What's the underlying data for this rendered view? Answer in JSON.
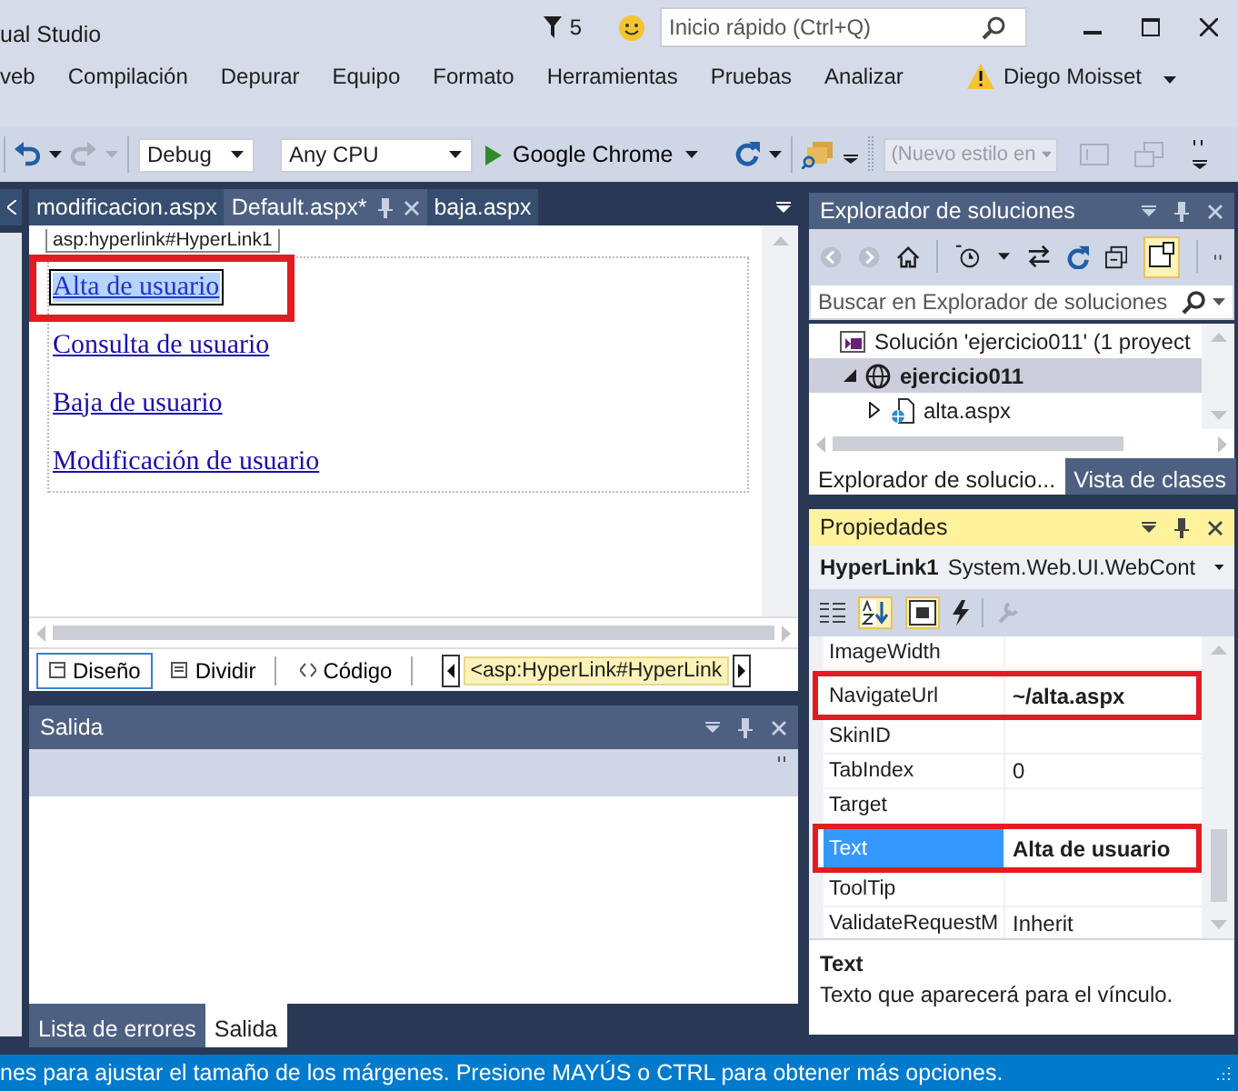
{
  "title_bar": {
    "title": "ual Studio",
    "notifications": "5",
    "quick_launch": {
      "placeholder": "Inicio rápido (Ctrl+Q)"
    }
  },
  "menu": [
    "veb",
    "Compilación",
    "Depurar",
    "Equipo",
    "Formato",
    "Herramientas",
    "Pruebas",
    "Analizar"
  ],
  "user": "Diego Moisset",
  "toolbar": {
    "configuration": "Debug",
    "platform": "Any CPU",
    "start_target": "Google Chrome",
    "style": {
      "value": "(Nuevo estilo en",
      "disabled": true
    }
  },
  "editor": {
    "tabs": [
      {
        "label": "modificacion.aspx",
        "selected": false
      },
      {
        "label": "Default.aspx*",
        "selected": true
      },
      {
        "label": "baja.aspx",
        "selected": false
      }
    ],
    "tag_label": "asp:hyperlink#HyperLink1",
    "links": [
      {
        "text": "Alta de usuario",
        "selected": true,
        "highlighted": true
      },
      {
        "text": "Consulta de usuario",
        "selected": false,
        "highlighted": false
      },
      {
        "text": "Baja de usuario",
        "selected": false,
        "highlighted": false
      },
      {
        "text": "Modificación de usuario",
        "selected": false,
        "highlighted": false
      }
    ],
    "view_tabs": [
      {
        "label": "Diseño",
        "selected": true
      },
      {
        "label": "Dividir",
        "selected": false
      },
      {
        "label": "Código",
        "selected": false
      }
    ],
    "breadcrumb": "<asp:HyperLink#HyperLink"
  },
  "output": {
    "title": "Salida",
    "tabs": [
      {
        "label": "Lista de errores",
        "selected": false
      },
      {
        "label": "Salida",
        "selected": true
      }
    ]
  },
  "solution_explorer": {
    "title": "Explorador de soluciones",
    "search": {
      "placeholder": "Buscar en Explorador de soluciones"
    },
    "tree": [
      {
        "label": "Solución 'ejercicio011'  (1 proyect",
        "kind": "solution",
        "selected": false,
        "children": [
          {
            "label": "ejercicio011",
            "kind": "project",
            "selected": true,
            "expanded": true,
            "children": [
              {
                "label": "alta.aspx",
                "kind": "file",
                "selected": false,
                "expanded": false
              }
            ]
          }
        ]
      }
    ],
    "tabs": [
      {
        "label": "Explorador de solucio...",
        "selected": true
      },
      {
        "label": "Vista de clases",
        "selected": false
      }
    ]
  },
  "properties": {
    "title": "Propiedades",
    "object": "HyperLink1",
    "type": "System.Web.UI.WebCont",
    "rows": [
      {
        "name": "ImageWidth",
        "selected": false,
        "highlighted": false
      },
      {
        "name": "NavigateUrl",
        "value": "~/alta.aspx",
        "selected": false,
        "highlighted": true,
        "modified": true
      },
      {
        "name": "SkinID",
        "selected": false,
        "highlighted": false
      },
      {
        "name": "TabIndex",
        "value": "0",
        "selected": false,
        "highlighted": false,
        "modified": false
      },
      {
        "name": "Target",
        "selected": false,
        "highlighted": false
      },
      {
        "name": "Text",
        "value": "Alta de usuario",
        "selected": true,
        "highlighted": true,
        "modified": true
      },
      {
        "name": "ToolTip",
        "selected": false,
        "highlighted": false
      },
      {
        "name": "ValidateRequestM",
        "value": "Inherit",
        "selected": false,
        "highlighted": false,
        "modified": false
      }
    ],
    "description_title": "Text",
    "description": "Texto que aparecerá para el vínculo."
  },
  "status_bar": "nes para ajustar el tamaño de los márgenes. Presione MAYÚS o CTRL para obtener más opciones."
}
